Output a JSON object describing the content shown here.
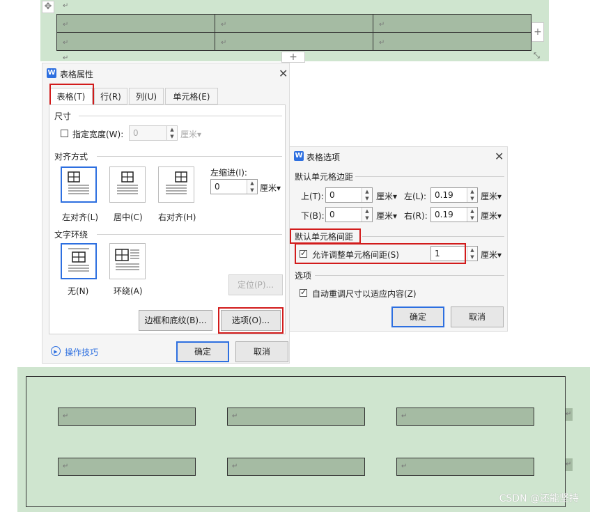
{
  "doc": {
    "paragraph_mark": "↵",
    "add_plus": "+",
    "resize_mark": "⤡",
    "move_mark": "✥",
    "top_rows": [
      [
        "↵",
        "↵",
        "↵"
      ],
      [
        "↵",
        "↵",
        "↵"
      ]
    ],
    "bottom_rows": [
      [
        "↵",
        "↵",
        "↵"
      ],
      [
        "↵",
        "↵",
        "↵"
      ]
    ]
  },
  "table_props": {
    "title": "表格属性",
    "logo": "W",
    "close": "✕",
    "tabs": [
      "表格(T)",
      "行(R)",
      "列(U)",
      "单元格(E)"
    ],
    "size_group": "尺寸",
    "specify_width": "指定宽度(W):",
    "width_value": "0",
    "width_unit": "厘米▾",
    "align_group": "对齐方式",
    "align_left": "左对齐(L)",
    "align_center": "居中(C)",
    "align_right": "右对齐(H)",
    "indent_label": "左缩进(I):",
    "indent_value": "0",
    "indent_unit": "厘米▾",
    "wrap_group": "文字环绕",
    "wrap_none": "无(N)",
    "wrap_around": "环绕(A)",
    "position_button": "定位(P)...",
    "borders_button": "边框和底纹(B)...",
    "options_button": "选项(O)...",
    "tips_link": "操作技巧",
    "ok": "确定",
    "cancel": "取消"
  },
  "table_options": {
    "title": "表格选项",
    "logo": "W",
    "close": "✕",
    "margins_group": "默认单元格边距",
    "top_label": "上(T):",
    "top_value": "0",
    "bottom_label": "下(B):",
    "bottom_value": "0",
    "left_label": "左(L):",
    "left_value": "0.19",
    "right_label": "右(R):",
    "right_value": "0.19",
    "unit": "厘米▾",
    "spacing_group": "默认单元格间距",
    "allow_spacing": "允许调整单元格间距(S)",
    "spacing_value": "1",
    "spacing_unit": "厘米▾",
    "options_group": "选项",
    "auto_resize": "自动重调尺寸以适应内容(Z)",
    "ok": "确定",
    "cancel": "取消"
  },
  "watermark": "CSDN @还能坚持",
  "colors": {
    "accent": "#2d6fe0",
    "highlight": "#d21b1b",
    "doc_bg": "#cfe5cf",
    "cell_bg": "#a5bba3"
  }
}
